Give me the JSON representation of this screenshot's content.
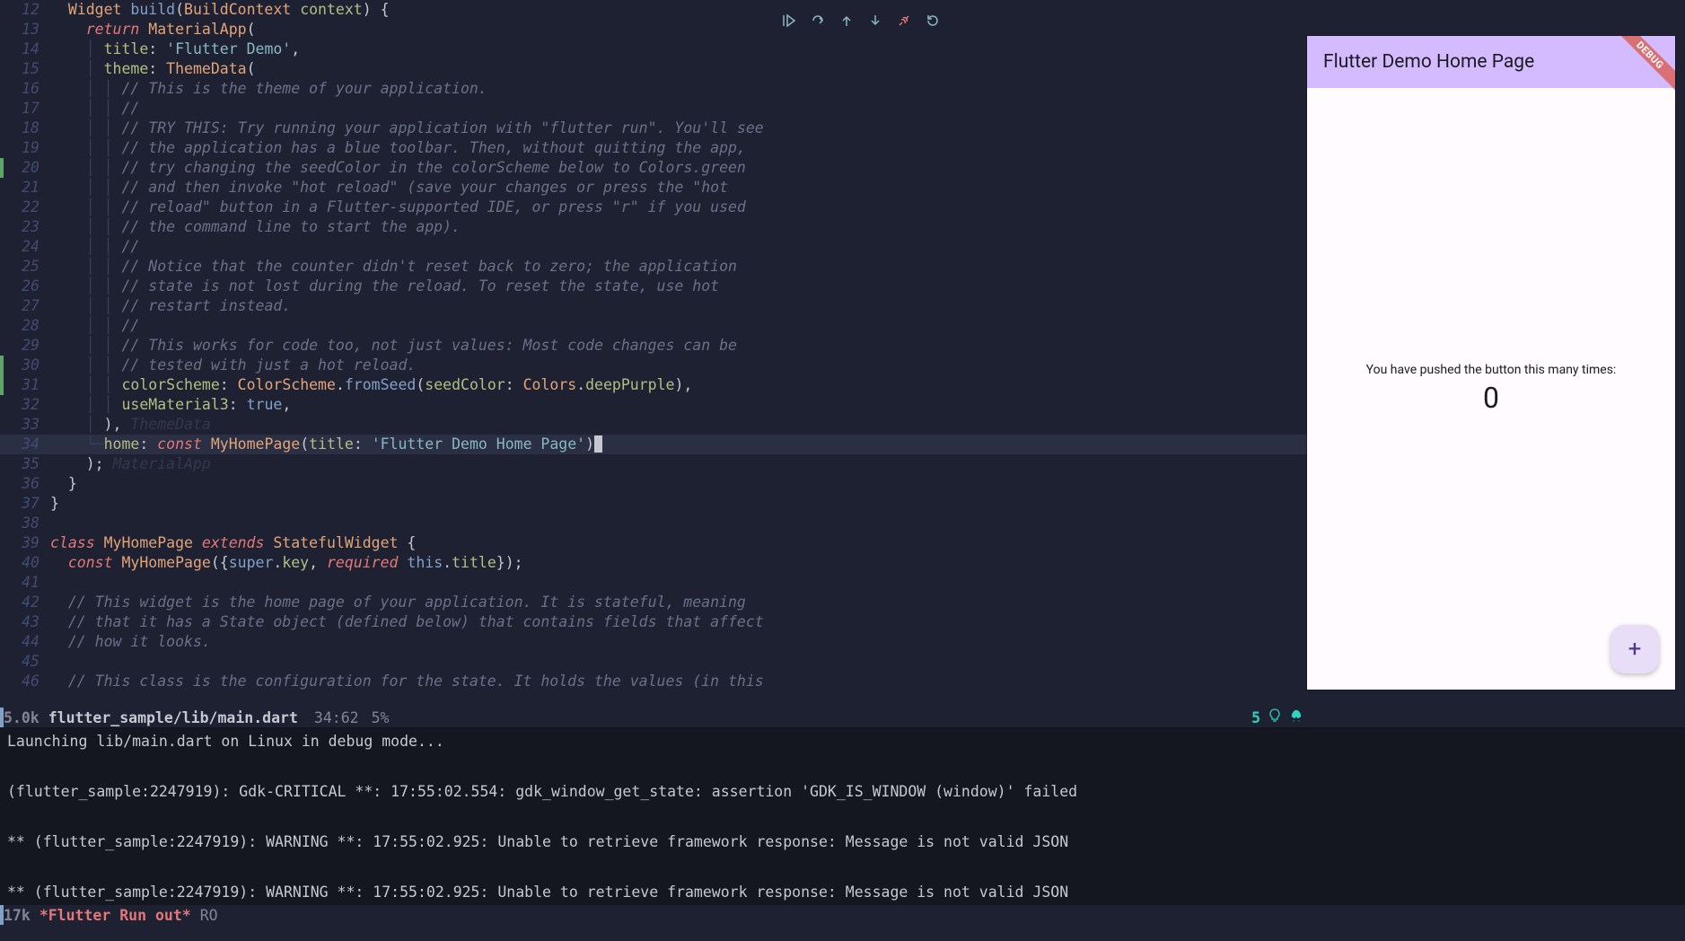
{
  "editor": {
    "lines": [
      {
        "n": 12,
        "html": "  <span class='ty'>Widget</span> <span class='fn'>build</span><span class='pn'>(</span><span class='ty'>BuildContext</span> <span class='id'>context</span><span class='pn'>)</span> <span class='pn'>{</span>"
      },
      {
        "n": 13,
        "html": "    <span class='kw'>return</span> <span class='ty'>MaterialApp</span><span class='pn'>(</span>"
      },
      {
        "n": 14,
        "html": "    <span class='guide'>│</span> <span class='id'>title</span><span class='pn'>:</span> <span class='st'>'Flutter Demo'</span><span class='pn'>,</span>"
      },
      {
        "n": 15,
        "html": "    <span class='guide'>│</span> <span class='id'>theme</span><span class='pn'>:</span> <span class='ty'>ThemeData</span><span class='pn'>(</span>"
      },
      {
        "n": 16,
        "html": "    <span class='guide'>│</span> <span class='guide'>│</span> <span class='cm'>// This is the theme of your application.</span>"
      },
      {
        "n": 17,
        "html": "    <span class='guide'>│</span> <span class='guide'>│</span> <span class='cm'>//</span>"
      },
      {
        "n": 18,
        "html": "    <span class='guide'>│</span> <span class='guide'>│</span> <span class='cm'>// TRY THIS: Try running your application with \"flutter run\". You'll see</span>"
      },
      {
        "n": 19,
        "html": "    <span class='guide'>│</span> <span class='guide'>│</span> <span class='cm'>// the application has a blue toolbar. Then, without quitting the app,</span>"
      },
      {
        "n": 20,
        "html": "    <span class='guide'>│</span> <span class='guide'>│</span> <span class='cm'>// try changing the seedColor in the colorScheme below to Colors.green</span>",
        "mark": true
      },
      {
        "n": 21,
        "html": "    <span class='guide'>│</span> <span class='guide'>│</span> <span class='cm'>// and then invoke \"hot reload\" (save your changes or press the \"hot</span>"
      },
      {
        "n": 22,
        "html": "    <span class='guide'>│</span> <span class='guide'>│</span> <span class='cm'>// reload\" button in a Flutter-supported IDE, or press \"r\" if you used</span>"
      },
      {
        "n": 23,
        "html": "    <span class='guide'>│</span> <span class='guide'>│</span> <span class='cm'>// the command line to start the app).</span>"
      },
      {
        "n": 24,
        "html": "    <span class='guide'>│</span> <span class='guide'>│</span> <span class='cm'>//</span>"
      },
      {
        "n": 25,
        "html": "    <span class='guide'>│</span> <span class='guide'>│</span> <span class='cm'>// Notice that the counter didn't reset back to zero; the application</span>"
      },
      {
        "n": 26,
        "html": "    <span class='guide'>│</span> <span class='guide'>│</span> <span class='cm'>// state is not lost during the reload. To reset the state, use hot</span>"
      },
      {
        "n": 27,
        "html": "    <span class='guide'>│</span> <span class='guide'>│</span> <span class='cm'>// restart instead.</span>"
      },
      {
        "n": 28,
        "html": "    <span class='guide'>│</span> <span class='guide'>│</span> <span class='cm'>//</span>"
      },
      {
        "n": 29,
        "html": "    <span class='guide'>│</span> <span class='guide'>│</span> <span class='cm'>// This works for code too, not just values: Most code changes can be</span>"
      },
      {
        "n": 30,
        "html": "    <span class='guide'>│</span> <span class='guide'>│</span> <span class='cm'>// tested with just a hot reload.</span>",
        "mark": true
      },
      {
        "n": 31,
        "html": "    <span class='guide'>│</span> <span class='guide'>│</span> <span class='id'>colorScheme</span><span class='pn'>:</span> <span class='ty'>ColorScheme</span><span class='pn'>.</span><span class='fn'>fromSeed</span><span class='pn'>(</span><span class='id'>seedColor</span><span class='pn'>:</span> <span class='ty'>Colors</span><span class='pn'>.</span><span class='id'>deepPurple</span><span class='pn'>),</span>",
        "mark": true
      },
      {
        "n": 32,
        "html": "    <span class='guide'>│</span> <span class='guide'>│</span> <span class='id'>useMaterial3</span><span class='pn'>:</span> <span class='bl'>true</span><span class='pn'>,</span>"
      },
      {
        "n": 33,
        "html": "    <span class='guide'>│</span> <span class='pn'>),</span> <span class='hint'>ThemeData</span>"
      },
      {
        "n": 34,
        "html": "    <span class='guide'>└─</span><span class='id'>home</span><span class='pn'>:</span> <span class='kw'>const</span> <span class='ty'>MyHomePage</span><span class='pn'>(</span><span class='id'>title</span><span class='pn'>:</span> <span class='st'>'Flutter Demo Home Page'</span><span class='pn'>)</span><span class='cursor'></span>",
        "hl": true
      },
      {
        "n": 35,
        "html": "    <span class='pn'>);</span> <span class='hint'>MaterialApp</span>"
      },
      {
        "n": 36,
        "html": "  <span class='pn'>}</span>"
      },
      {
        "n": 37,
        "html": "<span class='pn'>}</span>"
      },
      {
        "n": 38,
        "html": ""
      },
      {
        "n": 39,
        "html": "<span class='kw'>class</span> <span class='ty'>MyHomePage</span> <span class='kw'>extends</span> <span class='ty'>StatefulWidget</span> <span class='pn'>{</span>"
      },
      {
        "n": 40,
        "html": "  <span class='kw'>const</span> <span class='ty'>MyHomePage</span><span class='pn'>({</span><span class='bl'>super</span><span class='pn'>.</span><span class='id'>key</span><span class='pn'>,</span> <span class='kw'>required</span> <span class='bl'>this</span><span class='pn'>.</span><span class='id'>title</span><span class='pn'>});</span>"
      },
      {
        "n": 41,
        "html": ""
      },
      {
        "n": 42,
        "html": "  <span class='cm'>// This widget is the home page of your application. It is stateful, meaning</span>"
      },
      {
        "n": 43,
        "html": "  <span class='cm'>// that it has a State object (defined below) that contains fields that affect</span>"
      },
      {
        "n": 44,
        "html": "  <span class='cm'>// how it looks.</span>"
      },
      {
        "n": 45,
        "html": ""
      },
      {
        "n": 46,
        "html": "  <span class='cm'>// This class is the configuration for the state. It holds the values (in this</span>"
      }
    ]
  },
  "status1": {
    "size": "5.0k",
    "path": "flutter_sample/lib/main.dart",
    "pos": "34:62",
    "pct": "5%",
    "diag_count": "5"
  },
  "terminal": {
    "lines": [
      "Launching lib/main.dart on Linux in debug mode...",
      "",
      "(flutter_sample:2247919): Gdk-CRITICAL **: 17:55:02.554: gdk_window_get_state: assertion 'GDK_IS_WINDOW (window)' failed",
      "",
      "** (flutter_sample:2247919): WARNING **: 17:55:02.925: Unable to retrieve framework response: Message is not valid JSON",
      "",
      "** (flutter_sample:2247919): WARNING **: 17:55:02.925: Unable to retrieve framework response: Message is not valid JSON"
    ]
  },
  "status2": {
    "size": "17k",
    "buf": "*Flutter Run out*",
    "ro": "RO"
  },
  "preview": {
    "appbar_title": "Flutter Demo Home Page",
    "message": "You have pushed the button this many times:",
    "count": "0",
    "debug_banner": "DEBUG",
    "fab_icon": "+"
  },
  "debug_toolbar": {
    "continue": "▷",
    "step_over": "↷",
    "step_out": "↑",
    "step_into": "↓",
    "disconnect": "⚭",
    "restart": "↻"
  }
}
